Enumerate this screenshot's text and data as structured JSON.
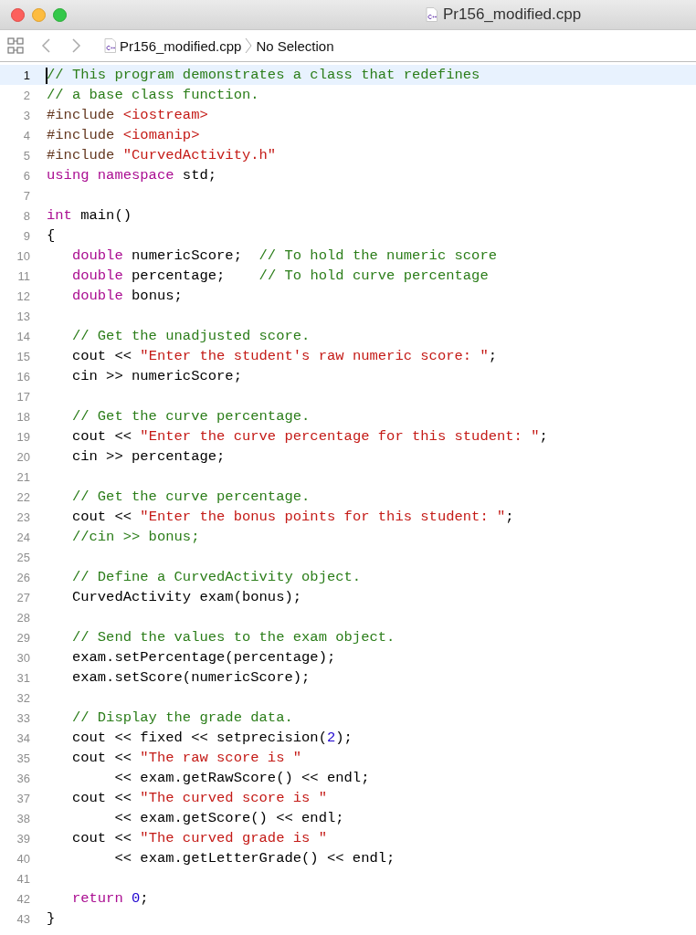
{
  "window": {
    "title": "Pr156_modified.cpp"
  },
  "jump_bar": {
    "file": "Pr156_modified.cpp",
    "selection": "No Selection"
  },
  "lines": [
    {
      "number": "1",
      "current": true,
      "tokens": [
        {
          "kind": "comment",
          "text": "// This program demonstrates a class that redefines"
        }
      ]
    },
    {
      "number": "2",
      "current": false,
      "tokens": [
        {
          "kind": "comment",
          "text": "// a base class function."
        }
      ]
    },
    {
      "number": "3",
      "current": false,
      "tokens": [
        {
          "kind": "preproc",
          "text": "#include "
        },
        {
          "kind": "string",
          "text": "<iostream>"
        }
      ]
    },
    {
      "number": "4",
      "current": false,
      "tokens": [
        {
          "kind": "preproc",
          "text": "#include "
        },
        {
          "kind": "string",
          "text": "<iomanip>"
        }
      ]
    },
    {
      "number": "5",
      "current": false,
      "tokens": [
        {
          "kind": "preproc",
          "text": "#include "
        },
        {
          "kind": "string",
          "text": "\"CurvedActivity.h\""
        }
      ]
    },
    {
      "number": "6",
      "current": false,
      "tokens": [
        {
          "kind": "keyword",
          "text": "using namespace"
        },
        {
          "kind": "plain",
          "text": " std;"
        }
      ]
    },
    {
      "number": "7",
      "current": false
    },
    {
      "number": "8",
      "current": false,
      "tokens": [
        {
          "kind": "keyword",
          "text": "int"
        },
        {
          "kind": "plain",
          "text": " main()"
        }
      ]
    },
    {
      "number": "9",
      "current": false,
      "tokens": [
        {
          "kind": "plain",
          "text": "{"
        }
      ]
    },
    {
      "number": "10",
      "current": false,
      "tokens": [
        {
          "kind": "keyword",
          "text": "   double"
        },
        {
          "kind": "plain",
          "text": " numericScore;  "
        },
        {
          "kind": "comment",
          "text": "// To hold the numeric score"
        }
      ]
    },
    {
      "number": "11",
      "current": false,
      "tokens": [
        {
          "kind": "keyword",
          "text": "   double"
        },
        {
          "kind": "plain",
          "text": " percentage;    "
        },
        {
          "kind": "comment",
          "text": "// To hold curve percentage"
        }
      ]
    },
    {
      "number": "12",
      "current": false,
      "tokens": [
        {
          "kind": "keyword",
          "text": "   double"
        },
        {
          "kind": "plain",
          "text": " bonus;"
        }
      ]
    },
    {
      "number": "13",
      "current": false
    },
    {
      "number": "14",
      "current": false,
      "tokens": [
        {
          "kind": "comment",
          "text": "   // Get the unadjusted score."
        }
      ]
    },
    {
      "number": "15",
      "current": false,
      "tokens": [
        {
          "kind": "plain",
          "text": "   cout << "
        },
        {
          "kind": "string",
          "text": "\"Enter the student's raw numeric score: \""
        },
        {
          "kind": "plain",
          "text": ";"
        }
      ]
    },
    {
      "number": "16",
      "current": false,
      "tokens": [
        {
          "kind": "plain",
          "text": "   cin >> numericScore;"
        }
      ]
    },
    {
      "number": "17",
      "current": false
    },
    {
      "number": "18",
      "current": false,
      "tokens": [
        {
          "kind": "comment",
          "text": "   // Get the curve percentage."
        }
      ]
    },
    {
      "number": "19",
      "current": false,
      "tokens": [
        {
          "kind": "plain",
          "text": "   cout << "
        },
        {
          "kind": "string",
          "text": "\"Enter the curve percentage for this student: \""
        },
        {
          "kind": "plain",
          "text": ";"
        }
      ]
    },
    {
      "number": "20",
      "current": false,
      "tokens": [
        {
          "kind": "plain",
          "text": "   cin >> percentage;"
        }
      ]
    },
    {
      "number": "21",
      "current": false
    },
    {
      "number": "22",
      "current": false,
      "tokens": [
        {
          "kind": "comment",
          "text": "   // Get the curve percentage."
        }
      ]
    },
    {
      "number": "23",
      "current": false,
      "tokens": [
        {
          "kind": "plain",
          "text": "   cout << "
        },
        {
          "kind": "string",
          "text": "\"Enter the bonus points for this student: \""
        },
        {
          "kind": "plain",
          "text": ";"
        }
      ]
    },
    {
      "number": "24",
      "current": false,
      "tokens": [
        {
          "kind": "comment",
          "text": "   //cin >> bonus;"
        }
      ]
    },
    {
      "number": "25",
      "current": false
    },
    {
      "number": "26",
      "current": false,
      "tokens": [
        {
          "kind": "comment",
          "text": "   // Define a CurvedActivity object."
        }
      ]
    },
    {
      "number": "27",
      "current": false,
      "tokens": [
        {
          "kind": "plain",
          "text": "   CurvedActivity exam(bonus);"
        }
      ]
    },
    {
      "number": "28",
      "current": false
    },
    {
      "number": "29",
      "current": false,
      "tokens": [
        {
          "kind": "comment",
          "text": "   // Send the values to the exam object."
        }
      ]
    },
    {
      "number": "30",
      "current": false,
      "tokens": [
        {
          "kind": "plain",
          "text": "   exam.setPercentage(percentage);"
        }
      ]
    },
    {
      "number": "31",
      "current": false,
      "tokens": [
        {
          "kind": "plain",
          "text": "   exam.setScore(numericScore);"
        }
      ]
    },
    {
      "number": "32",
      "current": false
    },
    {
      "number": "33",
      "current": false,
      "tokens": [
        {
          "kind": "comment",
          "text": "   // Display the grade data."
        }
      ]
    },
    {
      "number": "34",
      "current": false,
      "tokens": [
        {
          "kind": "plain",
          "text": "   cout << fixed << setprecision("
        },
        {
          "kind": "number",
          "text": "2"
        },
        {
          "kind": "plain",
          "text": ");"
        }
      ]
    },
    {
      "number": "35",
      "current": false,
      "tokens": [
        {
          "kind": "plain",
          "text": "   cout << "
        },
        {
          "kind": "string",
          "text": "\"The raw score is \""
        }
      ]
    },
    {
      "number": "36",
      "current": false,
      "tokens": [
        {
          "kind": "plain",
          "text": "        << exam.getRawScore() << endl;"
        }
      ]
    },
    {
      "number": "37",
      "current": false,
      "tokens": [
        {
          "kind": "plain",
          "text": "   cout << "
        },
        {
          "kind": "string",
          "text": "\"The curved score is \""
        }
      ]
    },
    {
      "number": "38",
      "current": false,
      "tokens": [
        {
          "kind": "plain",
          "text": "        << exam.getScore() << endl;"
        }
      ]
    },
    {
      "number": "39",
      "current": false,
      "tokens": [
        {
          "kind": "plain",
          "text": "   cout << "
        },
        {
          "kind": "string",
          "text": "\"The curved grade is \""
        }
      ]
    },
    {
      "number": "40",
      "current": false,
      "tokens": [
        {
          "kind": "plain",
          "text": "        << exam.getLetterGrade() << endl;"
        }
      ]
    },
    {
      "number": "41",
      "current": false
    },
    {
      "number": "42",
      "current": false,
      "tokens": [
        {
          "kind": "keyword",
          "text": "   return"
        },
        {
          "kind": "number",
          "text": " 0"
        },
        {
          "kind": "plain",
          "text": ";"
        }
      ]
    },
    {
      "number": "43",
      "current": false,
      "tokens": [
        {
          "kind": "plain",
          "text": "}"
        }
      ]
    }
  ]
}
